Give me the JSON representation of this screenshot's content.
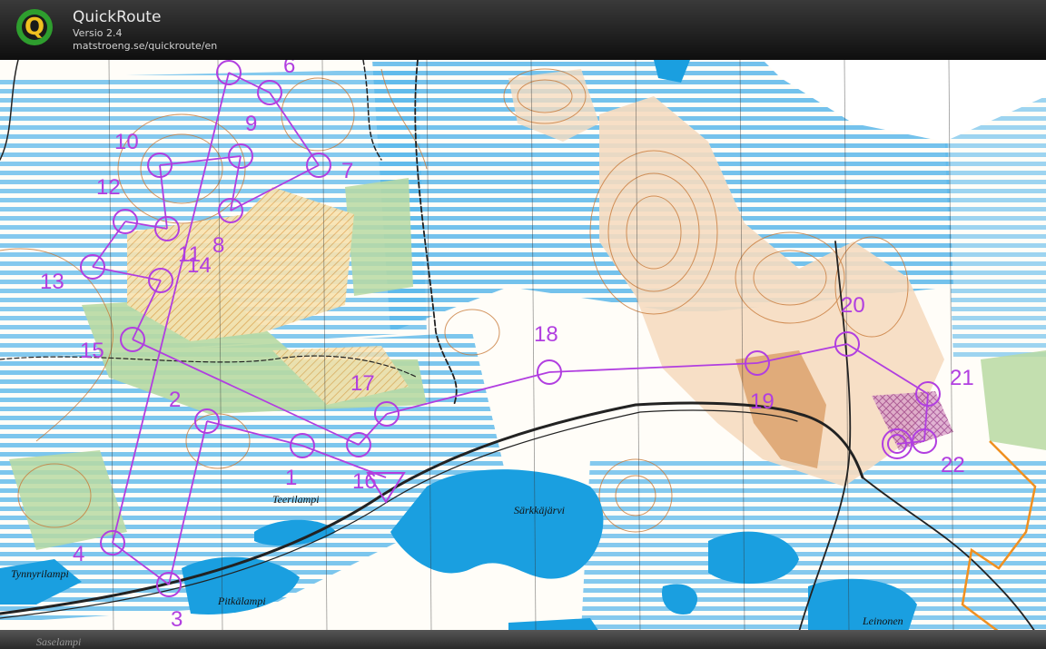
{
  "app": {
    "title": "QuickRoute",
    "version": "Versio 2.4",
    "url": "matstroeng.se/quickroute/en",
    "logo_letter": "Q"
  },
  "colors": {
    "course": "#b13ee0",
    "water": "#1a9fe0",
    "marsh": "#4fb3e8",
    "vegetation": "#b8d9a2",
    "contour": "#c87a3a",
    "open_land": "#f2c27a",
    "road": "#222222"
  },
  "map": {
    "place_names": [
      "Teerilampi",
      "Tynnyrilampi",
      "Pitkälampi",
      "Särkkäjärvi",
      "Leinonen",
      "Saselampi"
    ]
  },
  "course": {
    "controls": [
      "1",
      "2",
      "3",
      "4",
      "6",
      "7",
      "8",
      "9",
      "10",
      "11",
      "12",
      "13",
      "14",
      "15",
      "16",
      "17",
      "18",
      "19",
      "20",
      "21",
      "22"
    ]
  }
}
